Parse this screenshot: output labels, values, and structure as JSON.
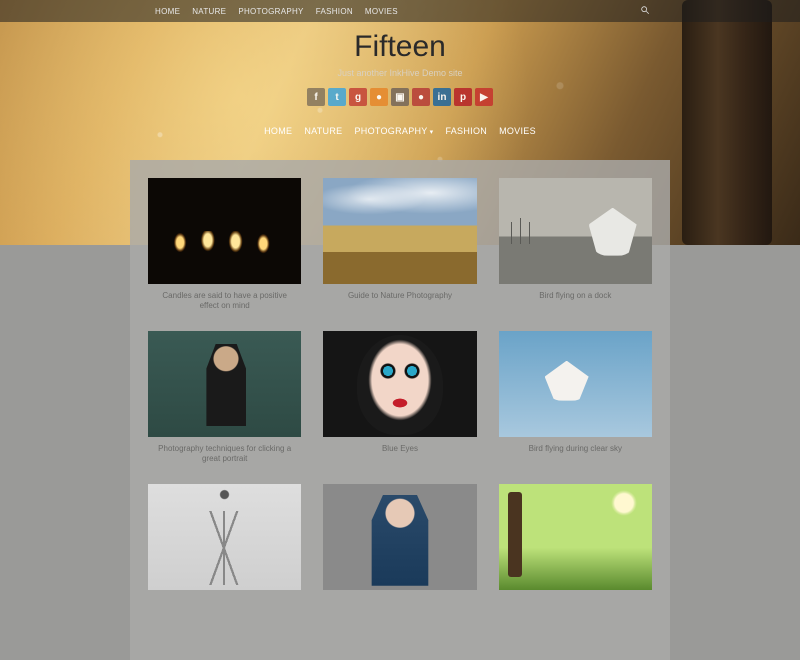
{
  "topnav": [
    "HOME",
    "NATURE",
    "PHOTOGRAPHY",
    "FASHION",
    "MOVIES"
  ],
  "site": {
    "title": "Fifteen",
    "tagline": "Just another InkHive Demo site"
  },
  "social": [
    {
      "name": "facebook",
      "bg": "#8a7a5e",
      "glyph": "f"
    },
    {
      "name": "twitter",
      "bg": "#4aa7d4",
      "glyph": "t"
    },
    {
      "name": "google-plus",
      "bg": "#c64a3a",
      "glyph": "g"
    },
    {
      "name": "rss",
      "bg": "#e68a2e",
      "glyph": "●"
    },
    {
      "name": "instagram",
      "bg": "#7a6a5a",
      "glyph": "▣"
    },
    {
      "name": "flickr",
      "bg": "#b8433a",
      "glyph": "●"
    },
    {
      "name": "linkedin",
      "bg": "#2a6a9a",
      "glyph": "in"
    },
    {
      "name": "pinterest",
      "bg": "#b82a2a",
      "glyph": "p"
    },
    {
      "name": "youtube",
      "bg": "#c6382e",
      "glyph": "▶"
    }
  ],
  "mainnav": [
    {
      "label": "HOME",
      "dropdown": false
    },
    {
      "label": "NATURE",
      "dropdown": false
    },
    {
      "label": "PHOTOGRAPHY",
      "dropdown": true
    },
    {
      "label": "FASHION",
      "dropdown": false
    },
    {
      "label": "MOVIES",
      "dropdown": false
    }
  ],
  "posts": [
    {
      "title": "Candles are said to have a positive effect on mind",
      "thumb": "th-candles"
    },
    {
      "title": "Guide to Nature Photography",
      "thumb": "th-hills"
    },
    {
      "title": "Bird flying on a dock",
      "thumb": "th-dock"
    },
    {
      "title": "Photography techniques for clicking a great portrait",
      "thumb": "th-man"
    },
    {
      "title": "Blue Eyes",
      "thumb": "th-face"
    },
    {
      "title": "Bird flying during clear sky",
      "thumb": "th-sky"
    },
    {
      "title": "",
      "thumb": "th-c1"
    },
    {
      "title": "",
      "thumb": "th-c2"
    },
    {
      "title": "",
      "thumb": "th-c3"
    }
  ]
}
